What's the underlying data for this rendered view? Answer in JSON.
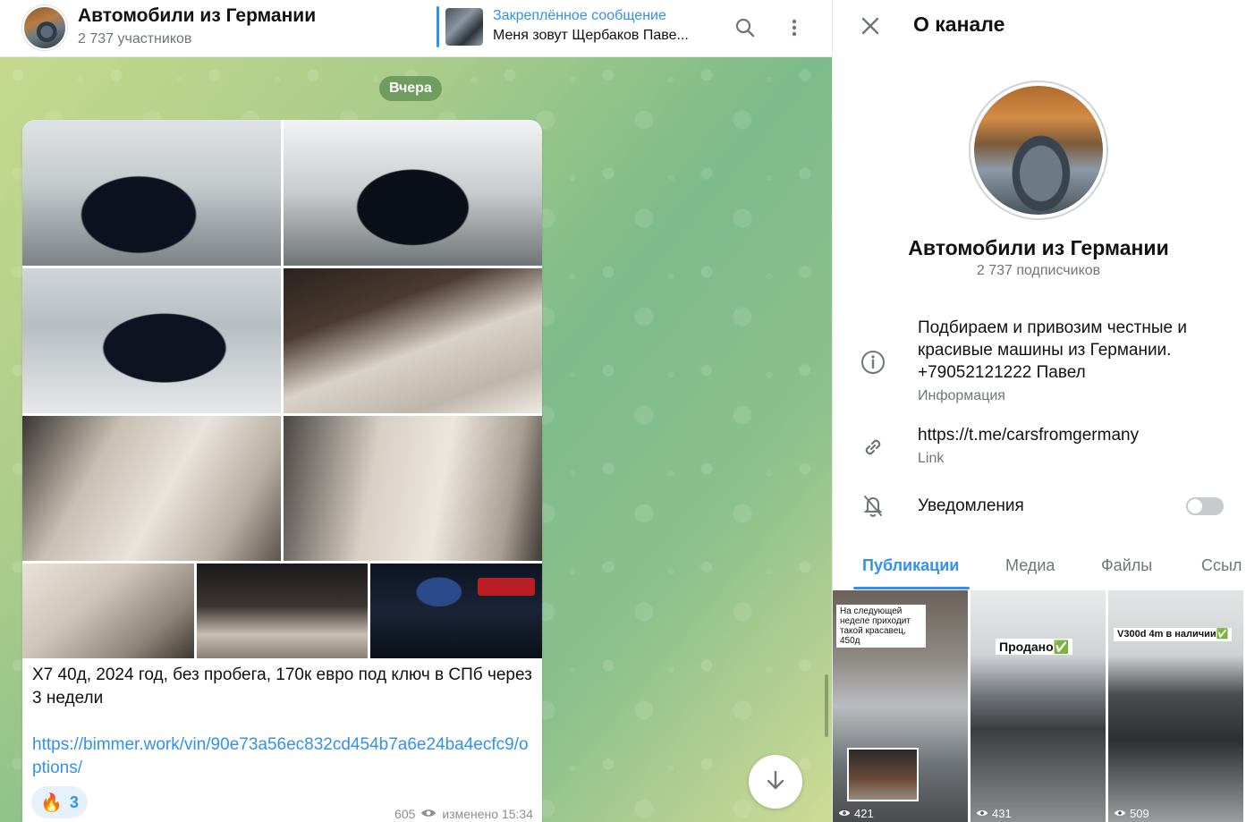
{
  "header": {
    "title": "Автомобили из Германии",
    "subtitle": "2 737 участников",
    "pinned": {
      "label": "Закреплённое сообщение",
      "text": "Меня зовут Щербаков Паве..."
    }
  },
  "chat": {
    "date_label": "Вчера",
    "message": {
      "text": "X7 40д, 2024 год, без пробега, 170к евро под ключ в СПб через 3 недели",
      "link": "https://bimmer.work/vin/90e73a56ec832cd454b7a6e24ba4ecfc9/options/",
      "reaction": {
        "emoji": "🔥",
        "count": "3"
      },
      "views": "605",
      "edited": "изменено 15:34"
    }
  },
  "panel": {
    "title": "О канале",
    "name": "Автомобили из Германии",
    "subscribers": "2 737 подписчиков",
    "description": "Подбираем и привозим честные и красивые машины из Германии. +79052121222 Павел",
    "description_label": "Информация",
    "link": "https://t.me/carsfromgermany",
    "link_label": "Link",
    "notifications_label": "Уведомления",
    "notifications_on": false,
    "tabs": [
      "Публикации",
      "Медиа",
      "Файлы",
      "Ссыл"
    ],
    "active_tab": "Публикации",
    "tiles": [
      {
        "caption": "На следующей неделе приходит такой красавец, 450д",
        "views": "421"
      },
      {
        "caption": "Продано✅",
        "views": "431"
      },
      {
        "caption": "V300d 4m в наличии✅",
        "views": "509"
      }
    ]
  },
  "colors": {
    "accent": "#3390ec",
    "secondary_text": "#707579"
  }
}
